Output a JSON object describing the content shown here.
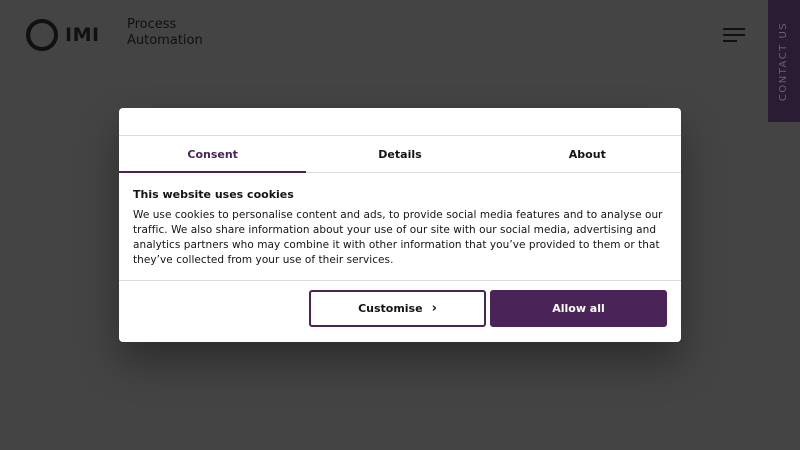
{
  "header": {
    "logo_text": "IMI",
    "brand_line1": "Process",
    "brand_line2": "Automation",
    "contact_tab": "CONTACT US"
  },
  "dialog": {
    "tabs": [
      {
        "label": "Consent",
        "active": true
      },
      {
        "label": "Details",
        "active": false
      },
      {
        "label": "About",
        "active": false
      }
    ],
    "heading": "This website uses cookies",
    "body": "We use cookies to personalise content and ads, to provide social media features and to analyse our traffic. We also share information about your use of our site with our social media, advertising and analytics partners who may combine it with other information that you’ve provided to them or that they’ve collected from your use of their services.",
    "customise_label": "Customise",
    "allow_all_label": "Allow all"
  },
  "colors": {
    "accent": "#4a2358",
    "overlay": "#444444",
    "contact_tab_bg": "#2a1c33"
  },
  "icons": {
    "menu": "hamburger-menu-icon",
    "customise": "chevron-right-icon"
  }
}
